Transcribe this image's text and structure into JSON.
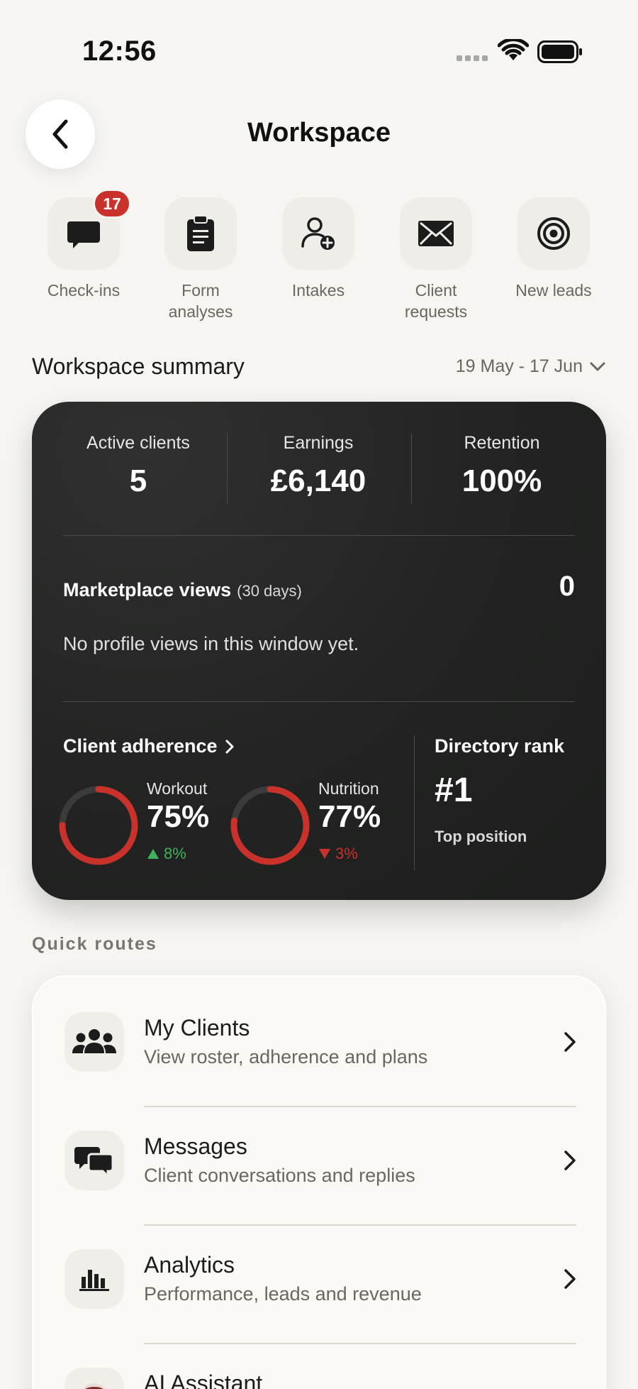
{
  "status_bar": {
    "time": "12:56"
  },
  "header": {
    "title": "Workspace"
  },
  "shortcuts": [
    {
      "label": "Check-ins",
      "icon": "chat-bubble-icon",
      "badge": "17"
    },
    {
      "label": "Form\nanalyses",
      "icon": "clipboard-icon"
    },
    {
      "label": "Intakes",
      "icon": "add-user-icon"
    },
    {
      "label": "Client\nrequests",
      "icon": "envelope-icon"
    },
    {
      "label": "New leads",
      "icon": "target-icon"
    }
  ],
  "summary": {
    "title": "Workspace summary",
    "date_range": "19 May - 17 Jun",
    "stats": [
      {
        "label": "Active clients",
        "value": "5"
      },
      {
        "label": "Earnings",
        "value": "£6,140"
      },
      {
        "label": "Retention",
        "value": "100%"
      }
    ],
    "marketplace": {
      "title": "Marketplace views",
      "period": "(30 days)",
      "count": "0",
      "note": "No profile views in this window yet."
    },
    "adherence": {
      "title": "Client adherence",
      "workout": {
        "label": "Workout",
        "value": "75%",
        "percent": 75,
        "delta": "8%",
        "direction": "up"
      },
      "nutrition": {
        "label": "Nutrition",
        "value": "77%",
        "percent": 77,
        "delta": "3%",
        "direction": "down"
      }
    },
    "rank": {
      "title": "Directory rank",
      "value": "#1",
      "note": "Top position"
    },
    "colors": {
      "ring": "#c8322a",
      "ring_track": "#3b3b3b",
      "up": "#3fb25a",
      "down": "#c8322a"
    }
  },
  "quick_routes": {
    "title": "Quick routes",
    "items": [
      {
        "title": "My Clients",
        "subtitle": "View roster, adherence and plans",
        "icon": "users-icon"
      },
      {
        "title": "Messages",
        "subtitle": "Client conversations and replies",
        "icon": "messages-icon"
      },
      {
        "title": "Analytics",
        "subtitle": "Performance, leads and revenue",
        "icon": "bar-chart-icon"
      },
      {
        "title": "AI Assistant",
        "subtitle": "",
        "icon": "assistant-icon"
      }
    ]
  }
}
